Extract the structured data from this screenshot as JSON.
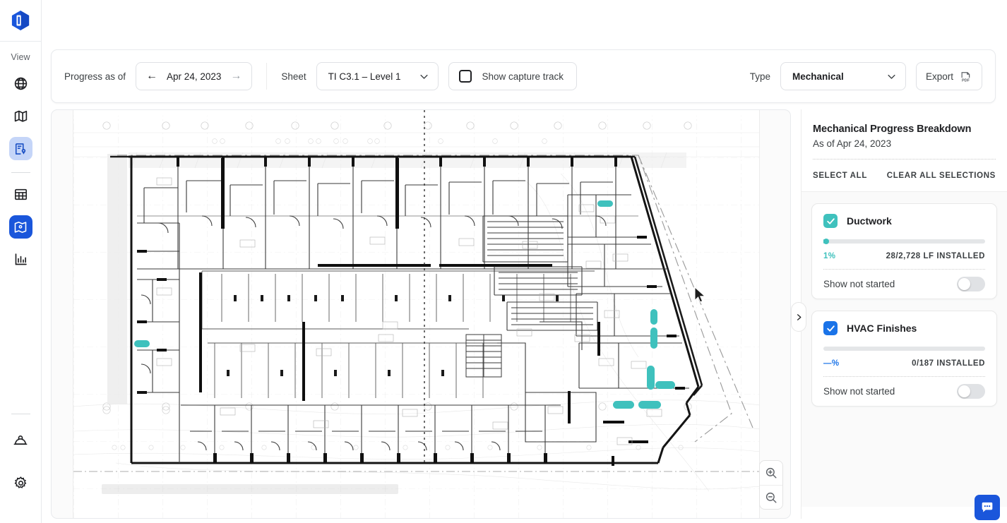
{
  "app": {
    "logo_icon": "hexagon-door-logo"
  },
  "sidebar": {
    "section_label": "View",
    "items": [
      {
        "name": "globe",
        "icon": "globe-icon",
        "state": "default"
      },
      {
        "name": "map",
        "icon": "map-icon",
        "state": "default"
      },
      {
        "name": "site-report",
        "icon": "clipboard-pin-icon",
        "state": "soft-selected"
      },
      {
        "name": "table",
        "icon": "table-icon",
        "state": "default"
      },
      {
        "name": "floorplan",
        "icon": "floorplan-pin-icon",
        "state": "active"
      },
      {
        "name": "analytics",
        "icon": "bar-chart-icon",
        "state": "default"
      }
    ],
    "bottom_items": [
      {
        "name": "safety",
        "icon": "hard-hat-icon"
      },
      {
        "name": "settings",
        "icon": "gear-icon"
      }
    ]
  },
  "toolbar": {
    "progress_label": "Progress as of",
    "date_value": "Apr 24, 2023",
    "prev_icon": "arrow-left-icon",
    "next_icon": "arrow-right-icon",
    "sheet_label": "Sheet",
    "sheet_value": "TI C3.1 – Level 1",
    "sheet_caret_icon": "chevron-down-icon",
    "capture_track_label": "Show capture track",
    "capture_track_icon": "rounded-square-icon",
    "capture_track_checked": false,
    "type_label": "Type",
    "type_value": "Mechanical",
    "type_caret_icon": "chevron-down-icon",
    "export_label": "Export",
    "export_icon": "pdf-icon"
  },
  "canvas": {
    "zoom_in_icon": "zoom-in-icon",
    "zoom_out_icon": "zoom-out-icon",
    "collapse_icon": "chevron-right-icon",
    "cursor_icon": "mouse-pointer-icon"
  },
  "panel": {
    "title": "Mechanical Progress Breakdown",
    "subtitle": "As of Apr 24, 2023",
    "select_all_label": "SELECT ALL",
    "clear_all_label": "CLEAR ALL SELECTIONS",
    "cards": [
      {
        "name": "Ductwork",
        "checked": true,
        "check_color": "#3fc1bd",
        "percent_label": "1%",
        "percent_value": 1,
        "installed_label": "28/2,728 LF INSTALLED",
        "show_not_started_label": "Show not started",
        "show_not_started_on": false
      },
      {
        "name": "HVAC Finishes",
        "checked": true,
        "check_color": "#1a73e8",
        "percent_label": "—%",
        "percent_value": 0,
        "installed_label": "0/187 INSTALLED",
        "show_not_started_label": "Show not started",
        "show_not_started_on": false
      }
    ]
  },
  "chat": {
    "icon": "chat-bubble-icon"
  }
}
